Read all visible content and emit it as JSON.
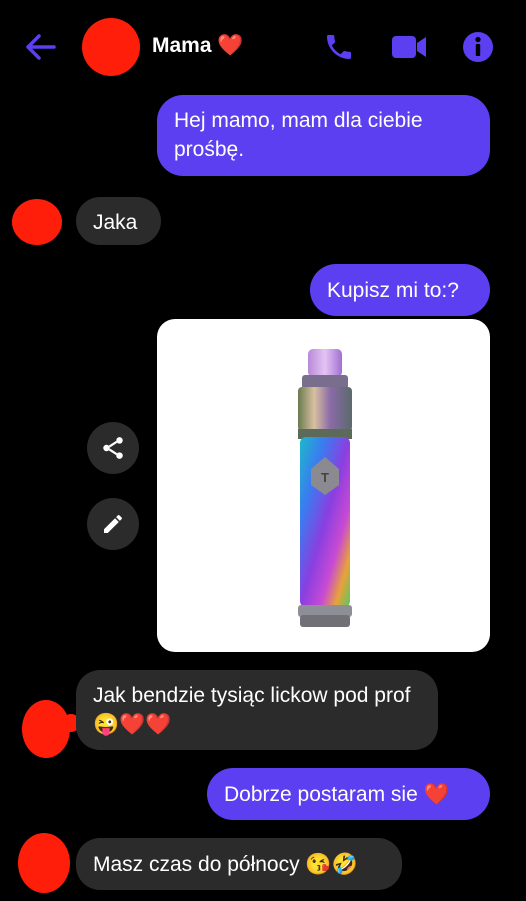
{
  "header": {
    "contact_name": "Mama",
    "contact_emoji": "❤️"
  },
  "messages": {
    "m1": "Hej mamo, mam dla ciebie prośbę.",
    "m2": "Jaka",
    "m3": "Kupisz mi to:?",
    "m5": "Jak bendzie tysiąc lickow pod prof 😜❤️❤️",
    "m6": "Dobrze postaram sie ❤️",
    "m7": "Masz czas do północy 😘🤣"
  },
  "icons": {
    "back": "back-arrow-icon",
    "call": "phone-icon",
    "video": "video-camera-icon",
    "info": "info-icon",
    "share": "share-icon",
    "edit": "pencil-icon"
  },
  "colors": {
    "background": "#000000",
    "outgoing": "#5b3ff0",
    "incoming": "#2b2b2b",
    "accent": "#5b3ff0",
    "redaction": "#ff1e0a"
  }
}
